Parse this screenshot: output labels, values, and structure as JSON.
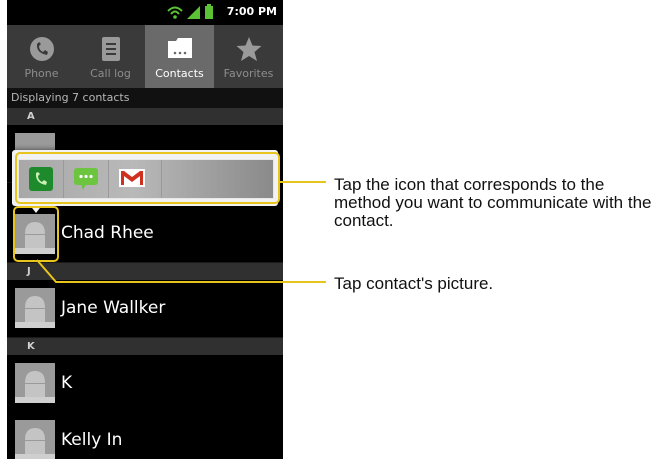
{
  "status_bar": {
    "time": "7:00 PM"
  },
  "tabs": [
    {
      "label": "Phone",
      "icon": "phone-icon",
      "active": false
    },
    {
      "label": "Call log",
      "icon": "call-log-icon",
      "active": false
    },
    {
      "label": "Contacts",
      "icon": "contacts-icon",
      "active": true
    },
    {
      "label": "Favorites",
      "icon": "star-icon",
      "active": false
    }
  ],
  "list": {
    "summary": "Displaying 7 contacts",
    "sections": [
      "A",
      "J",
      "K"
    ],
    "contacts": [
      "Chad Rhee",
      "Jane Wallker",
      "K",
      "Kelly In"
    ]
  },
  "quick_contact": {
    "actions": [
      {
        "name": "call",
        "icon": "phone-call-icon",
        "color": "#1f8a2c"
      },
      {
        "name": "message",
        "icon": "message-icon",
        "color": "#6cc43f"
      },
      {
        "name": "email",
        "icon": "gmail-icon",
        "color": "#d0311f"
      }
    ]
  },
  "callouts": {
    "icons_text": "Tap the icon that corresponds to the method you want to communicate with the contact.",
    "picture_text": "Tap contact's picture."
  },
  "colors": {
    "accent": "#e8c51c"
  }
}
